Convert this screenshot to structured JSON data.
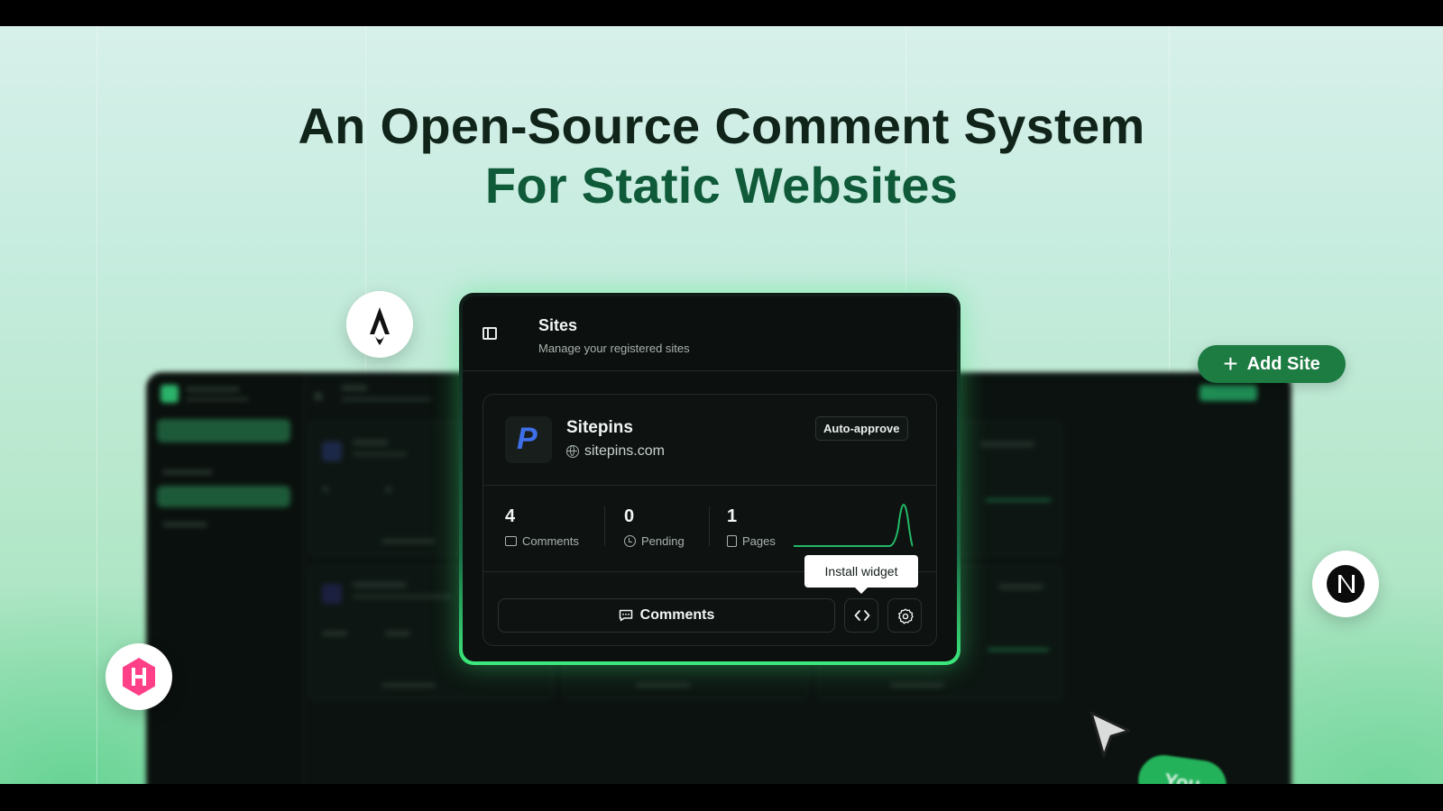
{
  "headline": {
    "line1": "An Open-Source Comment System",
    "line2": "For Static Websites"
  },
  "panel": {
    "title": "Sites",
    "subtitle": "Manage your registered sites",
    "toggle_icon": "sidebar-toggle-icon"
  },
  "site": {
    "logo_letter": "P",
    "name": "Sitepins",
    "url": "sitepins.com",
    "badge": "Auto-approve",
    "stats": [
      {
        "value": "4",
        "label": "Comments",
        "icon": "comment-icon"
      },
      {
        "value": "0",
        "label": "Pending",
        "icon": "clock-icon"
      },
      {
        "value": "1",
        "label": "Pages",
        "icon": "page-icon"
      }
    ],
    "tooltip": "Install widget",
    "comments_button": "Comments",
    "code_button_icon": "code-icon",
    "settings_button_icon": "gear-icon"
  },
  "floating": {
    "add_site": "Add Site",
    "cursor_label": "You",
    "astro_icon": "astro-logo-icon",
    "next_icon": "nextjs-logo-icon",
    "hugo_icon": "hugo-logo-icon"
  },
  "colors": {
    "accent": "#1c7c42",
    "headline_dark": "#10241a",
    "headline_green": "#0f5a38",
    "glow": "#3ce87c",
    "site_logo": "#3f6fe8"
  }
}
